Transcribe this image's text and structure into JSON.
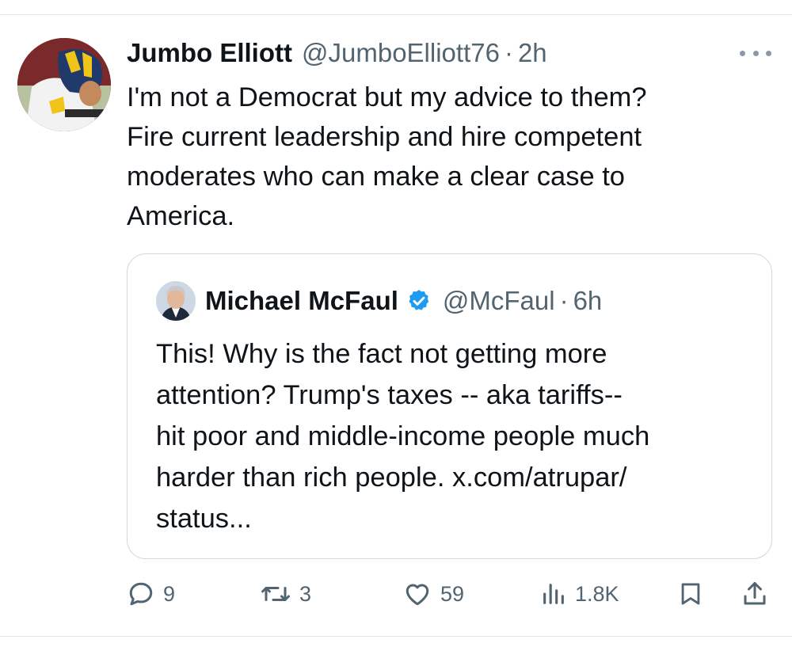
{
  "tweet": {
    "author_name": "Jumbo Elliott",
    "handle": "@JumboElliott76",
    "separator": "·",
    "time": "2h",
    "text": "I'm not a Democrat but my advice to them?\nFire current leadership and hire competent\nmoderates who can make a clear case to\nAmerica."
  },
  "quote": {
    "author_name": "Michael McFaul",
    "verified": true,
    "handle": "@McFaul",
    "separator": "·",
    "time": "6h",
    "text": "This!  Why is the fact not getting more\nattention?  Trump's taxes -- aka tariffs--\nhit poor and middle-income people much\nharder than rich people. x.com/atrupar/\nstatus..."
  },
  "actions": {
    "replies": "9",
    "reposts": "3",
    "likes": "59",
    "views": "1.8K"
  },
  "colors": {
    "text_primary": "#0f1419",
    "text_secondary": "#536471",
    "verified_blue": "#1d9bf0",
    "border": "#cfd9de"
  },
  "icons": [
    "more-icon",
    "verified-icon",
    "reply-icon",
    "repost-icon",
    "like-icon",
    "views-icon",
    "bookmark-icon",
    "share-icon"
  ]
}
